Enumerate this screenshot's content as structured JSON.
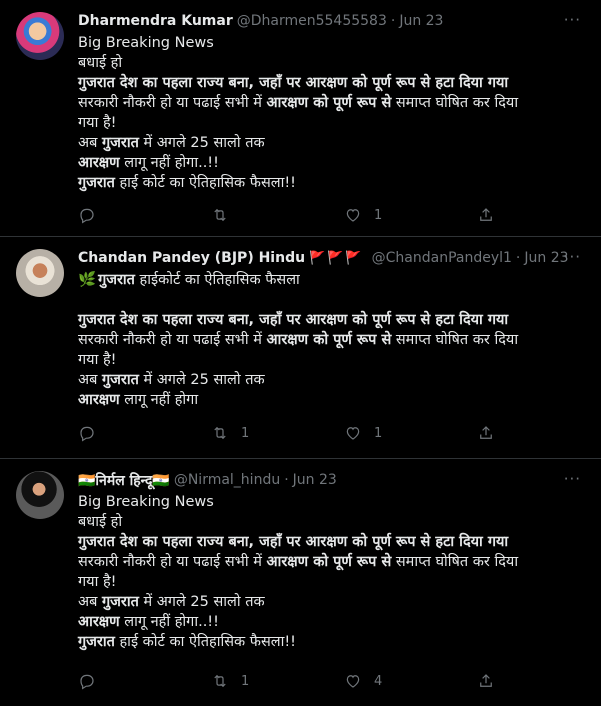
{
  "tweets": [
    {
      "name": "Dharmendra Kumar",
      "handle": "@Dharmen55455583",
      "sep": "·",
      "date": "Jun 23",
      "more": "···",
      "lines": {
        "l1": "Big Breaking News",
        "l2": "बधाई हो",
        "l3": "गुजरात देश का पहला राज्य बना, जहाँ पर आरक्षण को पूर्ण रूप से हटा दिया गया",
        "l4a": "सरकारी नौकरी हो या पढाई सभी में ",
        "l4b": "आरक्षण को पूर्ण रूप से",
        "l4c": " समाप्त घोषित कर दिया",
        "l5": "गया है!",
        "l6a": "अब ",
        "l6b": "गुजरात",
        "l6c": " में अगले 25 सालो तक",
        "l7a": "आरक्षण",
        "l7b": " लागू नहीं होगा..!!",
        "l8a": "गुजरात",
        "l8b": " हाई कोर्ट का ऐतिहासिक फैसला!!"
      },
      "reply_count": "",
      "retweet_count": "",
      "like_count": "1"
    },
    {
      "name": "Chandan Pandey (BJP) Hindu",
      "flags": "🚩🚩🚩",
      "handle": "@ChandanPandeyl1",
      "sep": "·",
      "date": "Jun 23",
      "more": "···",
      "lines": {
        "l1a": "🌿",
        "l1b": "गुजरात",
        "l1c": " हाईकोर्ट का ऐतिहासिक फैसला",
        "l3": "गुजरात देश का पहला राज्य बना, जहाँ पर आरक्षण को पूर्ण रूप से हटा दिया गया",
        "l4a": "सरकारी नौकरी हो या पढाई सभी में ",
        "l4b": "आरक्षण को पूर्ण रूप से",
        "l4c": " समाप्त घोषित कर दिया",
        "l5": "गया है!",
        "l6a": "अब ",
        "l6b": "गुजरात",
        "l6c": " में अगले 25 सालो तक",
        "l7a": "आरक्षण",
        "l7b": " लागू नहीं होगा"
      },
      "reply_count": "",
      "retweet_count": "1",
      "like_count": "1"
    },
    {
      "name": "🇮🇳निर्मल हिन्दू🇮🇳",
      "handle": "@Nirmal_hindu",
      "sep": "·",
      "date": "Jun 23",
      "more": "···",
      "lines": {
        "l1": "Big Breaking News",
        "l2": "बधाई हो",
        "l3": "गुजरात देश का पहला राज्य बना, जहाँ पर आरक्षण को पूर्ण रूप से हटा दिया गया",
        "l4a": "सरकारी नौकरी हो या पढाई सभी में ",
        "l4b": "आरक्षण को पूर्ण रूप से",
        "l4c": " समाप्त घोषित कर दिया",
        "l5": "गया है!",
        "l6a": "अब ",
        "l6b": "गुजरात",
        "l6c": " में अगले 25 सालो तक",
        "l7a": "आरक्षण",
        "l7b": " लागू नहीं होगा..!!",
        "l8a": "गुजरात",
        "l8b": " हाई कोर्ट का ऐतिहासिक फैसला!!"
      },
      "reply_count": "",
      "retweet_count": "1",
      "like_count": "4"
    }
  ],
  "icons": {
    "reply": "reply-icon",
    "retweet": "retweet-icon",
    "like": "heart-icon",
    "share": "share-icon",
    "more": "more-icon"
  }
}
